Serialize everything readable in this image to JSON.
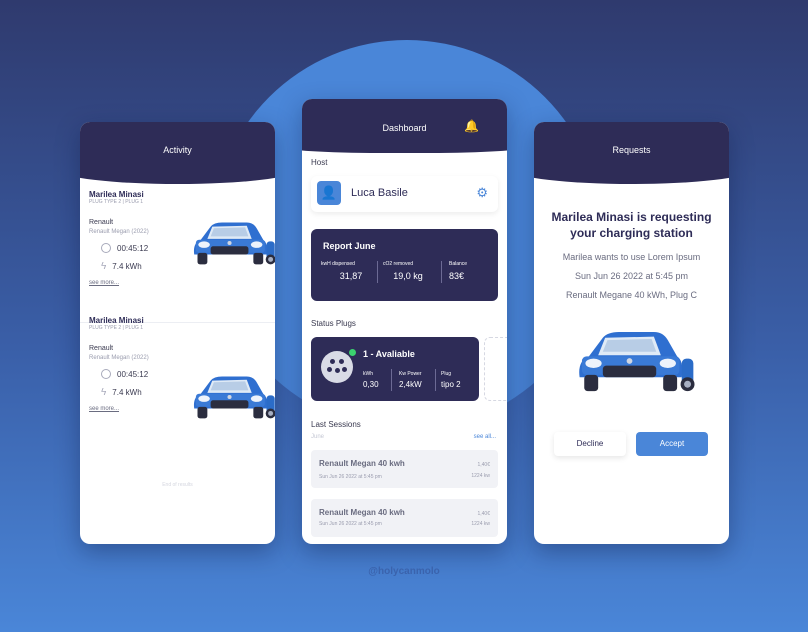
{
  "colors": {
    "navy": "#2e2c57",
    "accent": "#4a86d8",
    "bg_top": "#2f3a6e"
  },
  "watermark": "@holycanmolo",
  "activity": {
    "title": "Activity",
    "items": [
      {
        "name": "Marilea Minasi",
        "plug": "PLUG TYPE 2 | PLUG 1",
        "brand": "Renault",
        "model": "Renault Megan (2022)",
        "time": "00:45:12",
        "energy": "7.4 kWh",
        "see_more": "see more..."
      },
      {
        "name": "Marilea Minasi",
        "plug": "PLUG TYPE 2 | PLUG 1",
        "brand": "Renault",
        "model": "Renault Megan (2022)",
        "time": "00:45:12",
        "energy": "7.4 kWh",
        "see_more": "see more..."
      }
    ],
    "end": "End of results"
  },
  "dashboard": {
    "title": "Dashboard",
    "host_label": "Host",
    "host_name": "Luca Basile",
    "report": {
      "title": "Report June",
      "stats": [
        {
          "label": "kwH dispensed",
          "value": "31,87"
        },
        {
          "label": "cO2 removed",
          "value": "19,0 kg"
        },
        {
          "label": "Balance",
          "value": "83€"
        }
      ]
    },
    "status_label": "Status Plugs",
    "plug": {
      "title": "1 - Avaliable",
      "stats": [
        {
          "label": "kWh",
          "value": "0,30"
        },
        {
          "label": "Kw Power",
          "value": "2,4kW"
        },
        {
          "label": "Plug",
          "value": "tipo 2"
        }
      ]
    },
    "sessions_label": "Last Sessions",
    "month": "June",
    "see_all": "see all...",
    "sessions": [
      {
        "car": "Renault Megan 40 kwh",
        "date": "Sun Jun 26 2022 at 5:45 pm",
        "price": "1,40€",
        "kw": "1224 kw"
      },
      {
        "car": "Renault Megan 40 kwh",
        "date": "Sun Jun 26 2022 at 5:45 pm",
        "price": "1,40€",
        "kw": "1224 kw"
      }
    ]
  },
  "requests": {
    "title": "Requests",
    "heading": "Marilea Minasi is requesting your charging station",
    "line1": "Marilea wants to use Lorem Ipsum",
    "line2": "Sun Jun 26 2022 at 5:45 pm",
    "line3": "Renault Megane 40 kWh, Plug C",
    "decline": "Decline",
    "accept": "Accept"
  }
}
